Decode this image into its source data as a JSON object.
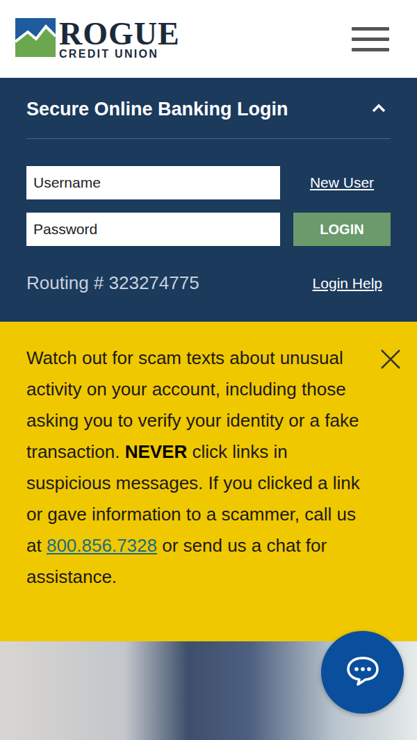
{
  "logo": {
    "name": "ROGUE",
    "subtitle": "CREDIT UNION"
  },
  "login": {
    "title": "Secure Online Banking Login",
    "expanded": true,
    "username": {
      "placeholder": "Username"
    },
    "password": {
      "placeholder": "Password"
    },
    "new_user": "New User",
    "login_button": "LOGIN",
    "routing": "Routing # 323274775",
    "login_help": "Login Help"
  },
  "alert": {
    "text_before": "Watch out for scam texts about unusual activity on your account, including those asking you to verify your identity or a fake transaction. ",
    "emphasis": "NEVER",
    "text_after": " click links in suspicious messages. If you clicked a link or gave information to a scammer, call us at ",
    "phone": "800.856.7328",
    "text_end": " or send us a chat for assistance."
  }
}
